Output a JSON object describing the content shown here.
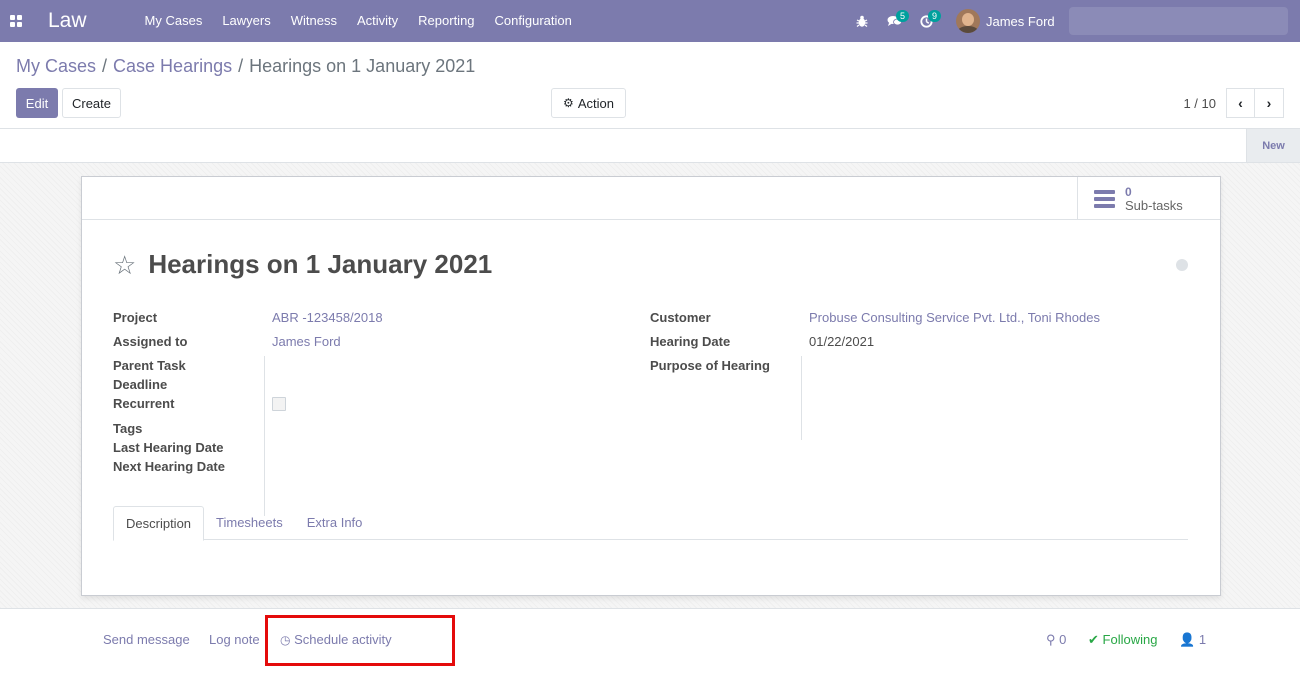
{
  "navbar": {
    "brand": "Law",
    "menu": [
      "My Cases",
      "Lawyers",
      "Witness",
      "Activity",
      "Reporting",
      "Configuration"
    ],
    "messages_count": "5",
    "activities_count": "9",
    "user_name": "James Ford",
    "icons": [
      "apps-grid-icon",
      "bug-icon",
      "chat-icon",
      "clock-icon"
    ]
  },
  "breadcrumb": {
    "items": [
      "My Cases",
      "Case Hearings"
    ],
    "current": "Hearings on 1 January 2021",
    "separator": "/"
  },
  "toolbar": {
    "edit_label": "Edit",
    "create_label": "Create",
    "action_label": "Action",
    "pager": "1 / 10"
  },
  "statusbar": {
    "stage": "New"
  },
  "smart_button": {
    "count": "0",
    "label": "Sub-tasks"
  },
  "record": {
    "title": "Hearings on 1 January 2021",
    "left_fields": [
      {
        "label": "Project",
        "value": "ABR -123458/2018"
      },
      {
        "label": "Assigned to",
        "value": "James Ford"
      },
      {
        "label": "Parent Task",
        "value": ""
      },
      {
        "label": "Deadline",
        "value": ""
      },
      {
        "label": "Recurrent",
        "value": ""
      },
      {
        "label": "Tags",
        "value": ""
      },
      {
        "label": "Last Hearing Date",
        "value": ""
      },
      {
        "label": "Next Hearing Date",
        "value": ""
      }
    ],
    "right_fields": [
      {
        "label": "Customer",
        "value": "Probuse Consulting Service Pvt. Ltd., Toni Rhodes"
      },
      {
        "label": "Hearing Date",
        "value": "01/22/2021"
      },
      {
        "label": "Purpose of Hearing",
        "value": ""
      }
    ]
  },
  "tabs": [
    "Description",
    "Timesheets",
    "Extra Info"
  ],
  "chatter": {
    "send_message": "Send message",
    "log_note": "Log note",
    "schedule_activity": "Schedule activity",
    "attachments": "0",
    "following": "Following",
    "followers": "1"
  },
  "colors": {
    "primary": "#7c7bad",
    "badge": "#00a09d",
    "following": "#28a745",
    "highlight": "#e40b0b"
  }
}
